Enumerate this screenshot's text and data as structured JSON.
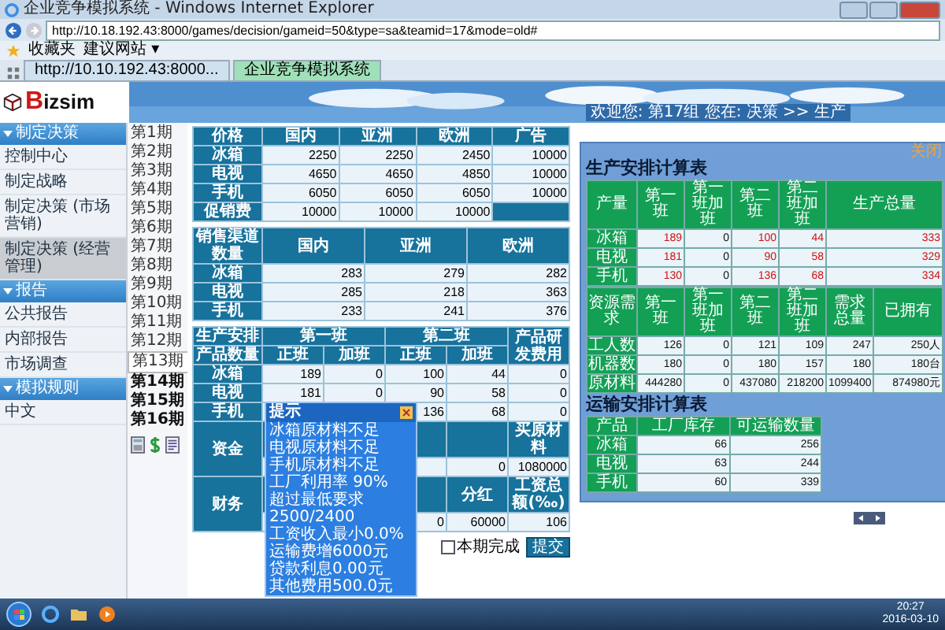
{
  "browser": {
    "title": "企业竞争模拟系统 - Windows Internet Explorer",
    "url": "http://10.18.192.43:8000/games/decision/gameid=50&type=sa&teamid=17&mode=old#",
    "favorites": [
      "收藏夹",
      "建议网站 ▾"
    ],
    "tabs": [
      {
        "label": "http://10.10.192.43:8000...",
        "selected": false
      },
      {
        "label": "企业竞争模拟系统",
        "selected": true
      }
    ]
  },
  "header": {
    "logo": "Bizsim",
    "greeting": "欢迎您: 第17组  您在: 决策 >> 生产"
  },
  "sidebar": [
    {
      "title": "制定决策",
      "items": [
        {
          "label": "控制中心",
          "selected": false
        },
        {
          "label": "制定战略",
          "selected": false
        },
        {
          "label": "制定决策 (市场营销)",
          "selected": false
        },
        {
          "label": "制定决策 (经营管理)",
          "selected": true
        }
      ]
    },
    {
      "title": "报告",
      "items": [
        {
          "label": "公共报告",
          "selected": false
        },
        {
          "label": "内部报告",
          "selected": false
        },
        {
          "label": "市场调查",
          "selected": false
        }
      ]
    },
    {
      "title": "模拟规则",
      "items": [
        {
          "label": "中文",
          "selected": false
        }
      ]
    }
  ],
  "periods": [
    {
      "label": "第1期",
      "kind": "past"
    },
    {
      "label": "第2期",
      "kind": "past"
    },
    {
      "label": "第3期",
      "kind": "past"
    },
    {
      "label": "第4期",
      "kind": "past"
    },
    {
      "label": "第5期",
      "kind": "past"
    },
    {
      "label": "第6期",
      "kind": "past"
    },
    {
      "label": "第7期",
      "kind": "past"
    },
    {
      "label": "第8期",
      "kind": "past"
    },
    {
      "label": "第9期",
      "kind": "past"
    },
    {
      "label": "第10期",
      "kind": "past"
    },
    {
      "label": "第11期",
      "kind": "past"
    },
    {
      "label": "第12期",
      "kind": "past"
    },
    {
      "label": "第13期",
      "kind": "current"
    },
    {
      "label": "第14期",
      "kind": "future"
    },
    {
      "label": "第15期",
      "kind": "future"
    },
    {
      "label": "第16期",
      "kind": "future"
    }
  ],
  "price_table": {
    "headers": [
      "价格",
      "国内",
      "亚洲",
      "欧洲",
      "广告"
    ],
    "rows": [
      {
        "label": "冰箱",
        "values": [
          "2250",
          "2250",
          "2450",
          "10000"
        ]
      },
      {
        "label": "电视",
        "values": [
          "4650",
          "4650",
          "4850",
          "10000"
        ]
      },
      {
        "label": "手机",
        "values": [
          "6050",
          "6050",
          "6050",
          "10000"
        ]
      },
      {
        "label": "促销费",
        "values": [
          "10000",
          "10000",
          "10000"
        ]
      }
    ]
  },
  "channel_table": {
    "headers": [
      "销售渠道数量",
      "国内",
      "亚洲",
      "欧洲"
    ],
    "rows": [
      {
        "label": "冰箱",
        "values": [
          "283",
          "279",
          "282"
        ]
      },
      {
        "label": "电视",
        "values": [
          "285",
          "218",
          "363"
        ]
      },
      {
        "label": "手机",
        "values": [
          "233",
          "241",
          "376"
        ]
      }
    ]
  },
  "production_table": {
    "corner": [
      "生产安排",
      "产品数量"
    ],
    "shifts": [
      {
        "title": "第一班",
        "columns": [
          "正班",
          "加班"
        ]
      },
      {
        "title": "第二班",
        "columns": [
          "正班",
          "加班"
        ]
      }
    ],
    "extra": "产品研发费用",
    "rows": [
      {
        "label": "冰箱",
        "values": [
          "189",
          "0",
          "100",
          "44",
          "0"
        ]
      },
      {
        "label": "电视",
        "values": [
          "181",
          "0",
          "90",
          "58",
          "0"
        ]
      },
      {
        "label": "手机",
        "values": [
          "136",
          "68",
          "0"
        ]
      }
    ],
    "finance": [
      {
        "label": "资金",
        "headers": [
          "买原材料"
        ],
        "values": [
          "0",
          "1080000"
        ]
      },
      {
        "label": "财务",
        "headers": [
          "分红",
          "工资总额(‰)"
        ],
        "values": [
          "0",
          "60000",
          "106"
        ]
      }
    ]
  },
  "popup": {
    "title": "提示",
    "lines": [
      "冰箱原材料不足",
      "电视原材料不足",
      "手机原材料不足",
      "工厂利用率 90%",
      "超过最低要求",
      "2500/2400",
      "工资收入最小0.0%",
      "运输费增6000元",
      "贷款利息0.00元",
      "其他费用500.0元"
    ]
  },
  "finish": {
    "label": "本期完成",
    "checked": false
  },
  "submit": "提交",
  "calc_panel": {
    "close": "关闭",
    "production": {
      "title": "生产安排计算表",
      "headers": [
        "产量",
        "第一班",
        "第一班加班",
        "第二班",
        "第二班加班",
        "生产总量"
      ],
      "rows": [
        {
          "label": "冰箱",
          "values": [
            {
              "text": "189",
              "alert": true
            },
            {
              "text": "0",
              "alert": false
            },
            {
              "text": "100",
              "alert": true
            },
            {
              "text": "44",
              "alert": true
            },
            {
              "text": "333",
              "alert": true
            }
          ]
        },
        {
          "label": "电视",
          "values": [
            {
              "text": "181",
              "alert": true
            },
            {
              "text": "0",
              "alert": false
            },
            {
              "text": "90",
              "alert": true
            },
            {
              "text": "58",
              "alert": true
            },
            {
              "text": "329",
              "alert": true
            }
          ]
        },
        {
          "label": "手机",
          "values": [
            {
              "text": "130",
              "alert": true
            },
            {
              "text": "0",
              "alert": false
            },
            {
              "text": "136",
              "alert": true
            },
            {
              "text": "68",
              "alert": true
            },
            {
              "text": "334",
              "alert": true
            }
          ]
        }
      ]
    },
    "resources": {
      "headers": [
        "资源需求",
        "第一班",
        "第一班加班",
        "第二班",
        "第二班加班",
        "需求总量",
        "已拥有"
      ],
      "rows": [
        {
          "label": "工人数",
          "values": [
            "126",
            "0",
            "121",
            "109",
            "247",
            "250人"
          ]
        },
        {
          "label": "机器数",
          "values": [
            "180",
            "0",
            "180",
            "157",
            "180",
            "180台"
          ]
        },
        {
          "label": "原材料",
          "values": [
            "444280",
            "0",
            "437080",
            "218200",
            "1099400",
            "874980元"
          ]
        }
      ]
    },
    "transport": {
      "title": "运输安排计算表",
      "headers": [
        "产品",
        "工厂库存",
        "可运输数量"
      ],
      "rows": [
        {
          "label": "冰箱",
          "values": [
            "66",
            "256"
          ]
        },
        {
          "label": "电视",
          "values": [
            "63",
            "244"
          ]
        },
        {
          "label": "手机",
          "values": [
            "60",
            "339"
          ]
        }
      ]
    }
  },
  "taskbar": {
    "time": "20:27",
    "date": "2016-03-10"
  }
}
